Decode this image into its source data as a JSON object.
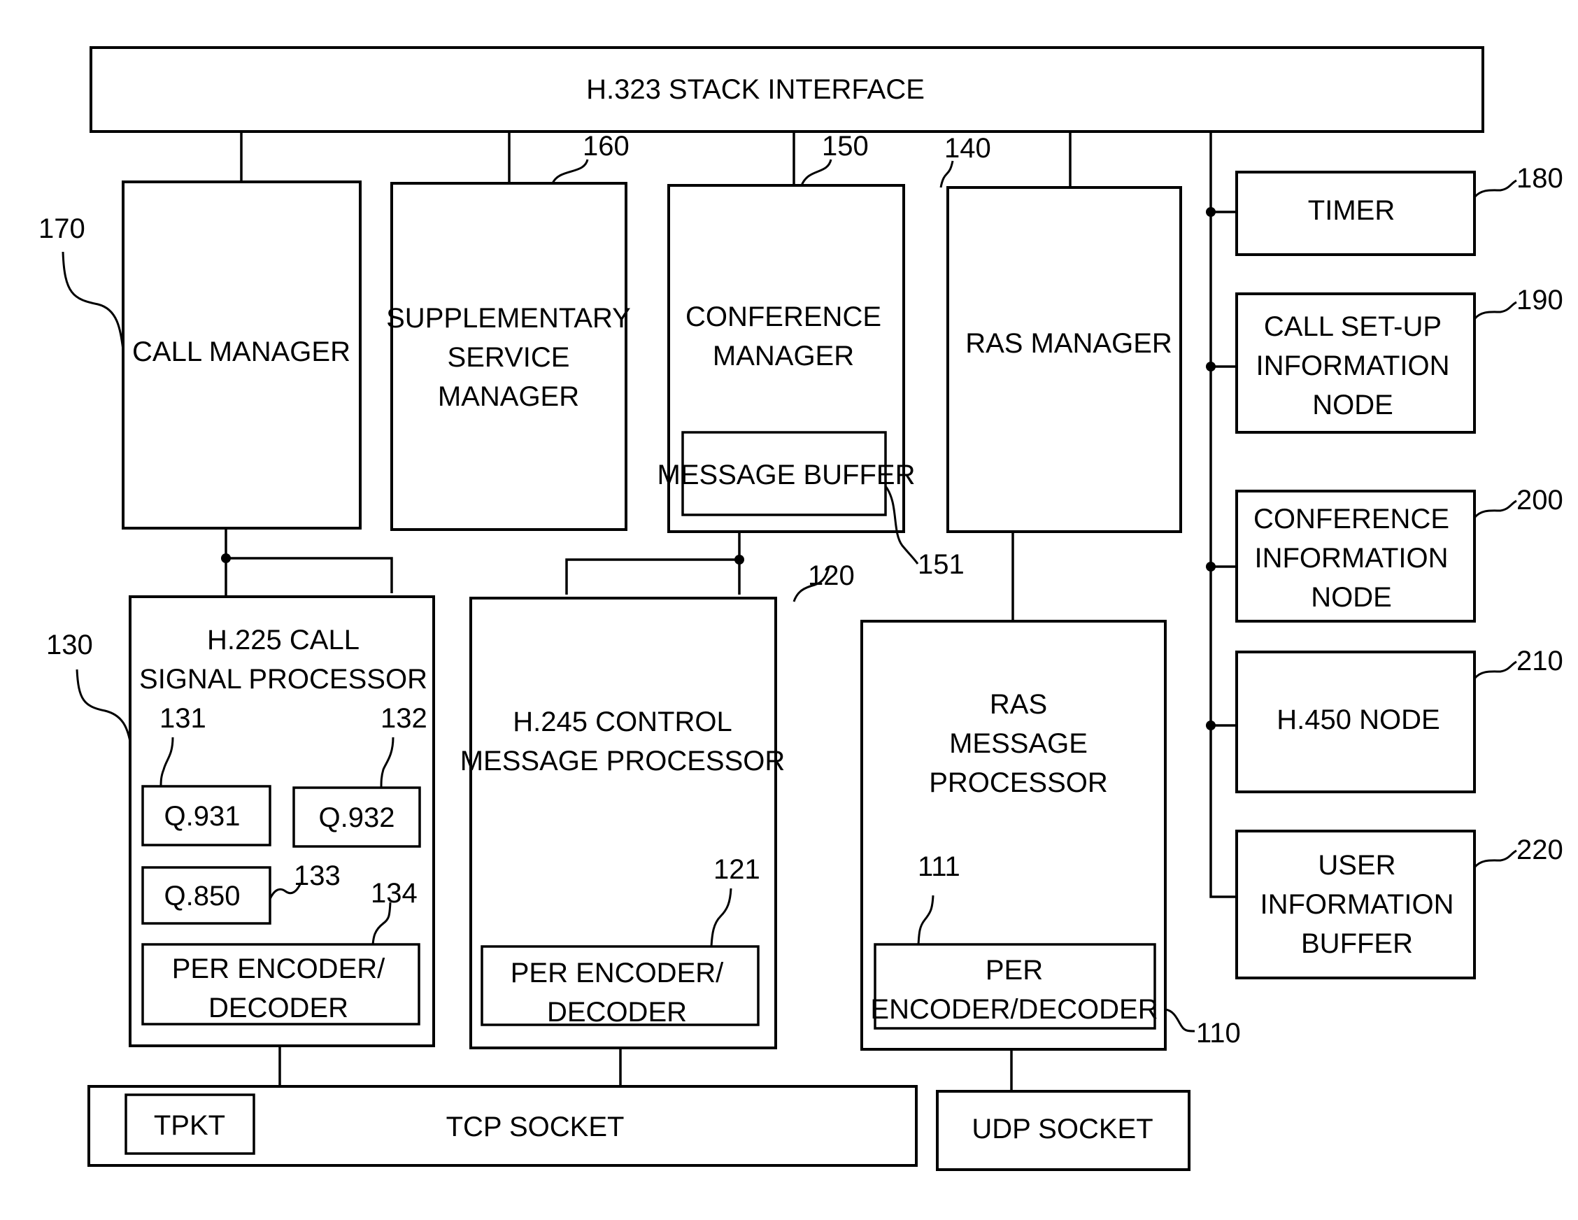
{
  "diagram": {
    "stack_interface": {
      "label": "H.323 STACK INTERFACE"
    },
    "call_manager": {
      "lines": [
        "CALL MANAGER"
      ],
      "ref": "170"
    },
    "supplementary": {
      "lines": [
        "SUPPLEMENTARY",
        "SERVICE",
        "MANAGER"
      ],
      "ref": "160"
    },
    "conference_manager": {
      "lines": [
        "CONFERENCE",
        "MANAGER"
      ],
      "ref": "150"
    },
    "message_buffer": {
      "lines": [
        "MESSAGE BUFFER"
      ],
      "ref": "151"
    },
    "ras_manager": {
      "lines": [
        "RAS MANAGER"
      ],
      "ref": "140"
    },
    "timer": {
      "lines": [
        "TIMER"
      ],
      "ref": "180"
    },
    "call_setup_node": {
      "lines": [
        "CALL SET-UP",
        "INFORMATION",
        "NODE"
      ],
      "ref": "190"
    },
    "conference_info_node": {
      "lines": [
        "CONFERENCE",
        "INFORMATION",
        "NODE"
      ],
      "ref": "200"
    },
    "h450_node": {
      "lines": [
        "H.450 NODE"
      ],
      "ref": "210"
    },
    "user_info_buffer": {
      "lines": [
        "USER",
        "INFORMATION",
        "BUFFER"
      ],
      "ref": "220"
    },
    "h225": {
      "lines": [
        "H.225 CALL",
        "SIGNAL PROCESSOR"
      ],
      "ref": "130"
    },
    "q931": {
      "lines": [
        "Q.931"
      ],
      "ref": "131"
    },
    "q932": {
      "lines": [
        "Q.932"
      ],
      "ref": "132"
    },
    "q850": {
      "lines": [
        "Q.850"
      ],
      "ref": "133"
    },
    "h225_per": {
      "lines": [
        "PER ENCODER/",
        "DECODER"
      ],
      "ref": "134"
    },
    "h245": {
      "lines": [
        "H.245 CONTROL",
        "MESSAGE PROCESSOR"
      ],
      "ref": "120"
    },
    "h245_per": {
      "lines": [
        "PER ENCODER/",
        "DECODER"
      ],
      "ref": "121"
    },
    "ras_processor": {
      "lines": [
        "RAS",
        "MESSAGE",
        "PROCESSOR"
      ],
      "ref": "110"
    },
    "ras_per": {
      "lines": [
        "PER",
        "ENCODER/DECODER"
      ],
      "ref": "111"
    },
    "tcp_socket": {
      "lines": [
        "TCP SOCKET"
      ]
    },
    "tpkt": {
      "lines": [
        "TPKT"
      ]
    },
    "udp_socket": {
      "lines": [
        "UDP SOCKET"
      ]
    }
  }
}
